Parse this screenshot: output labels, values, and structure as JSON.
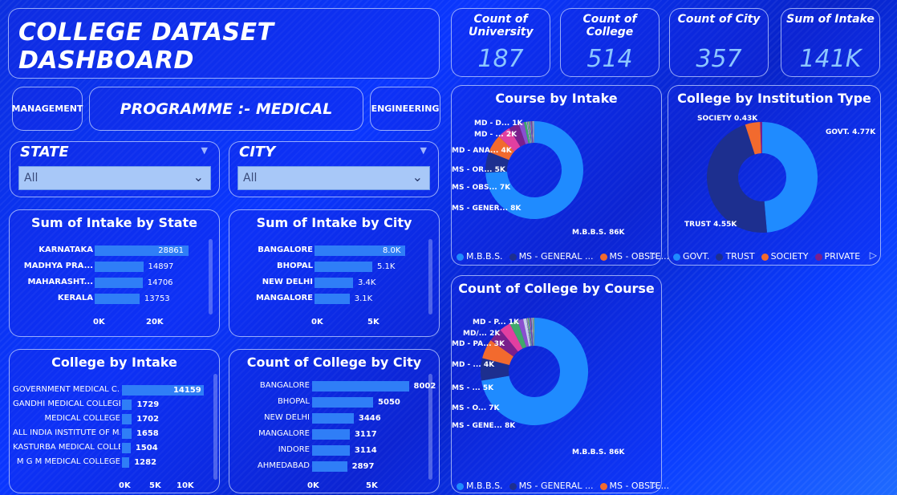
{
  "title": "COLLEGE DATASET DASHBOARD",
  "kpis": [
    {
      "label": "Count of University",
      "value": "187"
    },
    {
      "label": "Count of College",
      "value": "514"
    },
    {
      "label": "Count of City",
      "value": "357"
    },
    {
      "label": "Sum of Intake",
      "value": "141K"
    }
  ],
  "nav": {
    "management": "MANAGEMENT",
    "programme": "PROGRAMME :-  MEDICAL",
    "engineering": "ENGINEERING"
  },
  "slicers": {
    "state": {
      "title": "STATE",
      "value": "All"
    },
    "city": {
      "title": "CITY",
      "value": "All"
    }
  },
  "colors": {
    "bar": "#2f7ef7",
    "mbbs": "#1f8bff",
    "ms_general": "#1d2f8f",
    "ms_obste": "#f26a2e",
    "govt": "#1f8bff",
    "trust": "#1d2f8f",
    "society": "#f26a2e",
    "private": "#7a1f8c"
  },
  "chart_data": [
    {
      "type": "bar",
      "title": "Sum of Intake by State",
      "categories": [
        "KARNATAKA",
        "MADHYA PRA...",
        "MAHARASHT...",
        "KERALA"
      ],
      "values": [
        28861,
        14897,
        14706,
        13753
      ],
      "value_labels": [
        "28861",
        "14897",
        "14706",
        "13753"
      ],
      "xticks": [
        "0K",
        "20K"
      ]
    },
    {
      "type": "bar",
      "title": "Sum of Intake by City",
      "categories": [
        "BANGALORE",
        "BHOPAL",
        "NEW DELHI",
        "MANGALORE"
      ],
      "values": [
        8000,
        5100,
        3400,
        3100
      ],
      "value_labels": [
        "8.0K",
        "5.1K",
        "3.4K",
        "3.1K"
      ],
      "xticks": [
        "0K",
        "5K"
      ]
    },
    {
      "type": "bar",
      "title": "College by Intake",
      "categories": [
        "GOVERNMENT MEDICAL C...",
        "GANDHI MEDICAL COLLEGE",
        "MEDICAL COLLEGE",
        "ALL INDIA INSTITUTE OF M...",
        "KASTURBA MEDICAL COLLE...",
        "M G M MEDICAL COLLEGE"
      ],
      "values": [
        14159,
        1729,
        1702,
        1658,
        1504,
        1282
      ],
      "value_labels": [
        "14159",
        "1729",
        "1702",
        "1658",
        "1504",
        "1282"
      ],
      "xticks": [
        "0K",
        "5K",
        "10K"
      ]
    },
    {
      "type": "bar",
      "title": "Count of College by City",
      "categories": [
        "BANGALORE",
        "BHOPAL",
        "NEW DELHI",
        "MANGALORE",
        "INDORE",
        "AHMEDABAD"
      ],
      "values": [
        8002,
        5050,
        3446,
        3117,
        3114,
        2897
      ],
      "value_labels": [
        "8002",
        "5050",
        "3446",
        "3117",
        "3114",
        "2897"
      ],
      "xticks": [
        "0K",
        "5K"
      ]
    },
    {
      "type": "pie",
      "title": "Course by Intake",
      "slice_labels": [
        "M.B.B.S. 86K",
        "MS - GENER... 8K",
        "MS - OBS... 7K",
        "MS - OR... 5K",
        "MD - ANA... 4K",
        "MD - ... 2K",
        "MD - D... 1K"
      ],
      "legend": [
        "M.B.B.S.",
        "MS - GENERAL ...",
        "MS - OBSTE..."
      ],
      "values": [
        86,
        8,
        7,
        5,
        4,
        2,
        1
      ]
    },
    {
      "type": "pie",
      "title": "College by Institution Type",
      "slice_labels": [
        "GOVT. 4.77K",
        "TRUST 4.55K",
        "SOCIETY 0.43K"
      ],
      "legend": [
        "GOVT.",
        "TRUST",
        "SOCIETY",
        "PRIVATE"
      ],
      "values": [
        4770,
        4550,
        430,
        60
      ]
    },
    {
      "type": "pie",
      "title": "Count of College by Course",
      "slice_labels": [
        "M.B.B.S. 86K",
        "MS - GENE... 8K",
        "MS - O... 7K",
        "MS - ... 5K",
        "MD - ... 4K",
        "MD - PA... 3K",
        "MD/... 2K",
        "MD - P... 1K"
      ],
      "legend": [
        "M.B.B.S.",
        "MS - GENERAL ...",
        "MS - OBSTE..."
      ],
      "values": [
        86,
        8,
        7,
        5,
        4,
        3,
        2,
        1
      ]
    }
  ]
}
